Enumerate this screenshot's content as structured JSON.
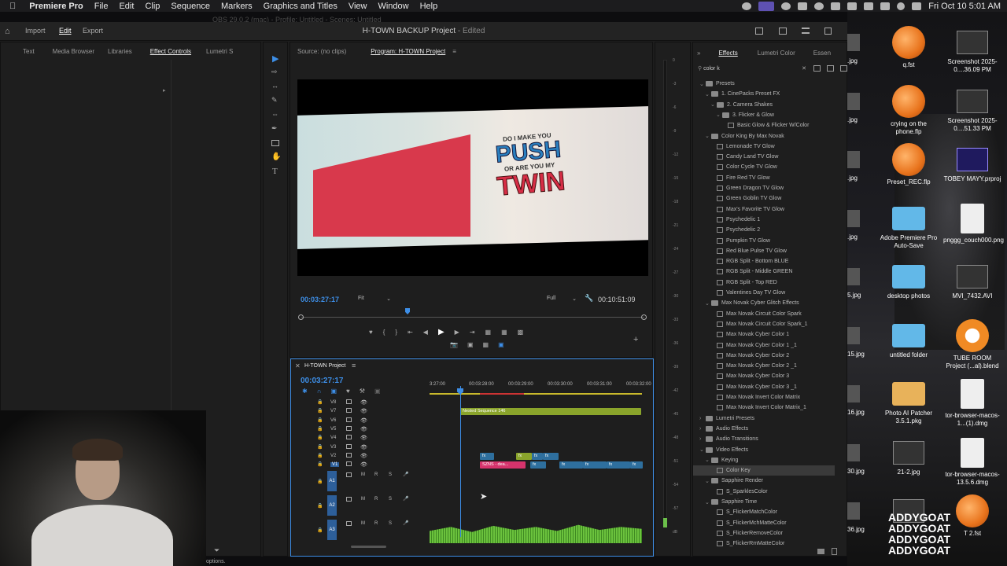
{
  "menubar": {
    "apple": "",
    "app": "Premiere Pro",
    "items": [
      "File",
      "Edit",
      "Clip",
      "Sequence",
      "Markers",
      "Graphics and Titles",
      "View",
      "Window",
      "Help"
    ],
    "datetime": "Fri Oct 10  5:01 AM"
  },
  "ghost_title": "OBS 29.0.2 (mac) - Profile: Untitled - Scenes: Untitled",
  "premiere": {
    "nav": {
      "import": "Import",
      "edit": "Edit",
      "export": "Export"
    },
    "project_title": "H-TOWN BACKUP Project",
    "project_status": "- Edited",
    "left_tabs": [
      "Text",
      "Media Browser",
      "Libraries",
      "Effect Controls",
      "Lumetri S"
    ],
    "source_tab": "Source: (no clips)",
    "program_tab": "Program: H-TOWN Project",
    "monitor": {
      "timecode": "00:03:27:17",
      "fit": "Fit",
      "quality": "Full",
      "duration": "00:10:51:09",
      "frame_text": [
        "DO I MAKE YOU",
        "PUSH",
        "OR ARE YOU MY",
        "TWIN"
      ]
    },
    "timeline": {
      "tab": "H-TOWN Project",
      "timecode": "00:03:27:17",
      "ruler": [
        "3:27:00",
        "00:03:28:00",
        "00:03:29:00",
        "00:03:30:00",
        "00:03:31:00",
        "00:03:32:00"
      ],
      "video_tracks": [
        "V8",
        "V7",
        "V6",
        "V5",
        "V4",
        "V3",
        "V2",
        "V1"
      ],
      "audio_tracks": [
        "A1",
        "A2",
        "A3"
      ],
      "nested_clip": "Nested Sequence 146",
      "szns_clip": "SZNS - dea...",
      "fx": "fx",
      "msr": [
        "M",
        "R",
        "S"
      ]
    },
    "meter_scale": [
      "0",
      "-3",
      "-6",
      "-9",
      "-12",
      "-15",
      "-18",
      "-21",
      "-24",
      "-27",
      "-30",
      "-33",
      "-36",
      "-39",
      "-42",
      "-45",
      "-48",
      "-51",
      "-54",
      "-57",
      "dB"
    ],
    "effects": {
      "tabs": [
        "Effects",
        "Lumetri Color",
        "Essen"
      ],
      "search": "color k",
      "rows": [
        {
          "label": "Presets",
          "level": 0,
          "kind": "folder",
          "tw": "v"
        },
        {
          "label": "1. CinePacks Preset FX",
          "level": 1,
          "kind": "folder",
          "tw": "v"
        },
        {
          "label": "2. Camera Shakes",
          "level": 2,
          "kind": "folder",
          "tw": "v"
        },
        {
          "label": "3. Flicker & Glow",
          "level": 3,
          "kind": "folder",
          "tw": "v"
        },
        {
          "label": "Basic Glow & Flicker W/Color",
          "level": 4,
          "kind": "fx",
          "tw": ""
        },
        {
          "label": "Color King By Max Novak",
          "level": 1,
          "kind": "folder",
          "tw": "v"
        },
        {
          "label": "Lemonade TV Glow",
          "level": 2,
          "kind": "fx",
          "tw": ""
        },
        {
          "label": "Candy Land TV Glow",
          "level": 2,
          "kind": "fx",
          "tw": ""
        },
        {
          "label": "Color Cycle TV Glow",
          "level": 2,
          "kind": "fx",
          "tw": ""
        },
        {
          "label": "Fire Red TV Glow",
          "level": 2,
          "kind": "fx",
          "tw": ""
        },
        {
          "label": "Green Dragon TV Glow",
          "level": 2,
          "kind": "fx",
          "tw": ""
        },
        {
          "label": "Green Goblin TV Glow",
          "level": 2,
          "kind": "fx",
          "tw": ""
        },
        {
          "label": "Max's Favorite TV Glow",
          "level": 2,
          "kind": "fx",
          "tw": ""
        },
        {
          "label": "Psychedelic 1",
          "level": 2,
          "kind": "fx",
          "tw": ""
        },
        {
          "label": "Psychedelic 2",
          "level": 2,
          "kind": "fx",
          "tw": ""
        },
        {
          "label": "Pumpkin TV Glow",
          "level": 2,
          "kind": "fx",
          "tw": ""
        },
        {
          "label": "Red Blue Pulse TV Glow",
          "level": 2,
          "kind": "fx",
          "tw": ""
        },
        {
          "label": "RGB Split - Bottom BLUE",
          "level": 2,
          "kind": "fx",
          "tw": ""
        },
        {
          "label": "RGB Split - Middle GREEN",
          "level": 2,
          "kind": "fx",
          "tw": ""
        },
        {
          "label": "RGB Split - Top RED",
          "level": 2,
          "kind": "fx",
          "tw": ""
        },
        {
          "label": "Valentines Day TV Glow",
          "level": 2,
          "kind": "fx",
          "tw": ""
        },
        {
          "label": "Max Novak Cyber Glitch Effects",
          "level": 1,
          "kind": "folder",
          "tw": "v"
        },
        {
          "label": "Max Novak Circuit Color Spark",
          "level": 2,
          "kind": "fx",
          "tw": ""
        },
        {
          "label": "Max Novak Circuit Color Spark_1",
          "level": 2,
          "kind": "fx",
          "tw": ""
        },
        {
          "label": "Max Novak Cyber Color 1",
          "level": 2,
          "kind": "fx",
          "tw": ""
        },
        {
          "label": "Max Novak Cyber Color 1 _1",
          "level": 2,
          "kind": "fx",
          "tw": ""
        },
        {
          "label": "Max Novak Cyber Color 2",
          "level": 2,
          "kind": "fx",
          "tw": ""
        },
        {
          "label": "Max Novak Cyber Color 2 _1",
          "level": 2,
          "kind": "fx",
          "tw": ""
        },
        {
          "label": "Max Novak Cyber Color 3",
          "level": 2,
          "kind": "fx",
          "tw": ""
        },
        {
          "label": "Max Novak Cyber Color 3 _1",
          "level": 2,
          "kind": "fx",
          "tw": ""
        },
        {
          "label": "Max Novak Invert Color Matrix",
          "level": 2,
          "kind": "fx",
          "tw": ""
        },
        {
          "label": "Max Novak Invert Color Matrix_1",
          "level": 2,
          "kind": "fx",
          "tw": ""
        },
        {
          "label": "Lumetri Presets",
          "level": 0,
          "kind": "folder",
          "tw": ">"
        },
        {
          "label": "Audio Effects",
          "level": 0,
          "kind": "folder",
          "tw": ">"
        },
        {
          "label": "Audio Transitions",
          "level": 0,
          "kind": "folder",
          "tw": ">"
        },
        {
          "label": "Video Effects",
          "level": 0,
          "kind": "folder",
          "tw": "v"
        },
        {
          "label": "Keying",
          "level": 1,
          "kind": "folder",
          "tw": "v"
        },
        {
          "label": "Color Key",
          "level": 2,
          "kind": "fx",
          "tw": "",
          "selected": true
        },
        {
          "label": "Sapphire Render",
          "level": 1,
          "kind": "folder",
          "tw": "v"
        },
        {
          "label": "S_SparklesColor",
          "level": 2,
          "kind": "fx",
          "tw": ""
        },
        {
          "label": "Sapphire Time",
          "level": 1,
          "kind": "folder",
          "tw": "v"
        },
        {
          "label": "S_FlickerMatchColor",
          "level": 2,
          "kind": "fx",
          "tw": ""
        },
        {
          "label": "S_FlickerMchMatteColor",
          "level": 2,
          "kind": "fx",
          "tw": ""
        },
        {
          "label": "S_FlickerRemoveColor",
          "level": 2,
          "kind": "fx",
          "tw": ""
        },
        {
          "label": "S_FlickerRmMatteColor",
          "level": 2,
          "kind": "fx",
          "tw": ""
        }
      ]
    },
    "status": "options."
  },
  "desktop": {
    "left_column": [
      ".jpg",
      ".jpg",
      ".jpg",
      ".jpg",
      "5.jpg",
      "15.jpg",
      "16.jpg",
      "30.jpg",
      "36.jpg"
    ],
    "icons": [
      {
        "label": "q.fst",
        "kind": "fl"
      },
      {
        "label": "Screenshot 2025-0....36.09 PM",
        "kind": "shot"
      },
      {
        "label": "crying on the phone.flp",
        "kind": "fl"
      },
      {
        "label": "Screenshot 2025-0....51.33 PM",
        "kind": "shot"
      },
      {
        "label": "Preset_REC.flp",
        "kind": "fl"
      },
      {
        "label": "TOBEY MAYY.prproj",
        "kind": "pr"
      },
      {
        "label": "Adobe Premiere Pro Auto-Save",
        "kind": "folder"
      },
      {
        "label": "pnggg_couch000.png",
        "kind": "doc"
      },
      {
        "label": "desktop photos",
        "kind": "folder"
      },
      {
        "label": "MVI_7432.AVI",
        "kind": "shot"
      },
      {
        "label": "untitled folder",
        "kind": "folder"
      },
      {
        "label": "TUBE ROOM Project (...al).blend",
        "kind": "blend"
      },
      {
        "label": "Photo AI Patcher 3.5.1.pkg",
        "kind": "pkg"
      },
      {
        "label": "tor-browser-macos-1...(1).dmg",
        "kind": "doc"
      },
      {
        "label": "21-2.jpg",
        "kind": "shot"
      },
      {
        "label": "tor-browser-macos-13.5.6.dmg",
        "kind": "doc"
      },
      {
        "label": "",
        "kind": "shot"
      },
      {
        "label": "T 2.fst",
        "kind": "fl"
      }
    ],
    "watermark": [
      "ADDYGOAT",
      "ADDYGOAT",
      "ADDYGOAT",
      "ADDYGOAT"
    ]
  },
  "colors": {
    "accent": "#3d8ee6",
    "green_clip": "#8aa42b",
    "pink_clip": "#d6336c",
    "teal_clip": "#2e6f9e",
    "audio": "#5fa832"
  }
}
